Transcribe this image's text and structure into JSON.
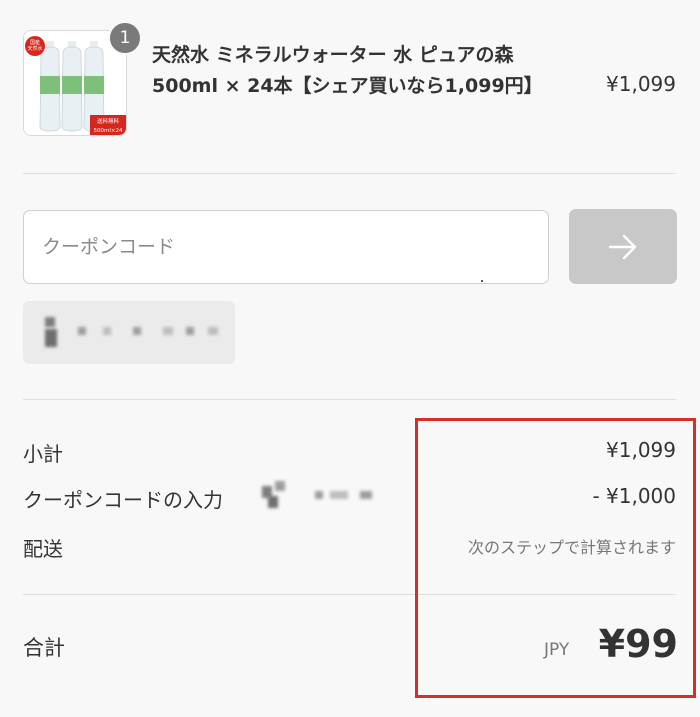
{
  "product": {
    "quantity": "1",
    "name": "天然水 ミネラルウォーター 水 ピュアの森 500ml × 24本【シェア買いなら1,099円】",
    "price": "¥1,099",
    "image_labels": {
      "tag_left": "国産天然水",
      "tag_right": "送料無料",
      "pack": "500ml×24"
    }
  },
  "coupon": {
    "placeholder": "クーポンコード",
    "value": "",
    "apply_icon": "arrow-right-icon"
  },
  "summary": {
    "subtotal_label": "小計",
    "subtotal_value": "¥1,099",
    "discount_label": "クーポンコードの入力",
    "discount_value": "- ¥1,000",
    "shipping_label": "配送",
    "shipping_value": "次のステップで計算されます"
  },
  "total": {
    "label": "合計",
    "currency": "JPY",
    "value": "¥99"
  },
  "colors": {
    "background": "#f8f8f8",
    "highlight": "#d42f2f",
    "button_disabled": "#c8c8c8"
  }
}
